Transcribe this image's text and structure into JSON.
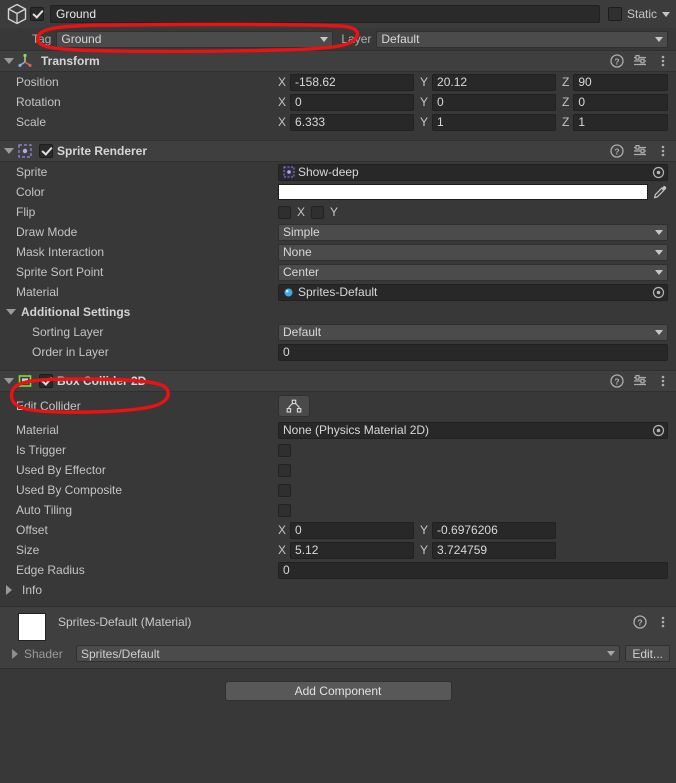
{
  "object_header": {
    "icon": "cube-icon",
    "enabled": true,
    "name": "Ground",
    "static_checked": false,
    "static_label": "Static"
  },
  "tag_layer": {
    "tag_label": "Tag",
    "tag_value": "Ground",
    "layer_label": "Layer",
    "layer_value": "Default"
  },
  "components": [
    {
      "title": "Transform",
      "icon": "transform-icon",
      "expanded": true,
      "has_enable_checkbox": false,
      "rows": [
        {
          "label": "Position",
          "type": "vector3",
          "x": "-158.62",
          "y": "20.12",
          "z": "90"
        },
        {
          "label": "Rotation",
          "type": "vector3",
          "x": "0",
          "y": "0",
          "z": "0"
        },
        {
          "label": "Scale",
          "type": "vector3",
          "x": "6.333",
          "y": "1",
          "z": "1"
        }
      ]
    },
    {
      "title": "Sprite Renderer",
      "icon": "sprite-renderer-icon",
      "expanded": true,
      "has_enable_checkbox": true,
      "enabled": true,
      "rows": [
        {
          "label": "Sprite",
          "type": "object",
          "value": "Show-deep"
        },
        {
          "label": "Color",
          "type": "color",
          "value": "#FFFFFF"
        },
        {
          "label": "Flip",
          "type": "flip",
          "x_label": "X",
          "y_label": "Y",
          "x": false,
          "y": false
        },
        {
          "label": "Draw Mode",
          "type": "dropdown",
          "value": "Simple"
        },
        {
          "label": "Mask Interaction",
          "type": "dropdown",
          "value": "None"
        },
        {
          "label": "Sprite Sort Point",
          "type": "dropdown",
          "value": "Center"
        },
        {
          "label": "Material",
          "type": "object",
          "value": "Sprites-Default"
        },
        {
          "label": "Additional Settings",
          "type": "section"
        },
        {
          "label": "Sorting Layer",
          "type": "dropdown",
          "indent": true,
          "value": "Default"
        },
        {
          "label": "Order in Layer",
          "type": "text",
          "indent": true,
          "value": "0"
        }
      ]
    },
    {
      "title": "Box Collider 2D",
      "icon": "box-collider-2d-icon",
      "expanded": true,
      "has_enable_checkbox": true,
      "enabled": true,
      "rows": [
        {
          "label": "Edit Collider",
          "type": "button",
          "icon": "edit-collider-icon"
        },
        {
          "label": "Material",
          "type": "object",
          "value": "None (Physics Material 2D)"
        },
        {
          "label": "Is Trigger",
          "type": "checkbox",
          "value": false
        },
        {
          "label": "Used By Effector",
          "type": "checkbox",
          "value": false
        },
        {
          "label": "Used By Composite",
          "type": "checkbox",
          "value": false
        },
        {
          "label": "Auto Tiling",
          "type": "checkbox",
          "value": false
        },
        {
          "label": "Offset",
          "type": "vector2",
          "x": "0",
          "y": "-0.6976206"
        },
        {
          "label": "Size",
          "type": "vector2",
          "x": "5.12",
          "y": "3.724759"
        },
        {
          "label": "Edge Radius",
          "type": "text",
          "value": "0"
        },
        {
          "label": "Info",
          "type": "foldout-closed"
        }
      ]
    }
  ],
  "material_block": {
    "title": "Sprites-Default (Material)",
    "swatch_color": "#FFFFFF",
    "shader_label": "Shader",
    "shader_value": "Sprites/Default",
    "edit_label": "Edit..."
  },
  "add_component": {
    "label": "Add Component"
  },
  "annotations": {
    "color": "#EE1111",
    "items": [
      {
        "name": "tag-dropdown-highlight",
        "shape": "ellipse-scribble"
      },
      {
        "name": "box-collider-2d-header-highlight",
        "shape": "ellipse-scribble"
      }
    ]
  }
}
